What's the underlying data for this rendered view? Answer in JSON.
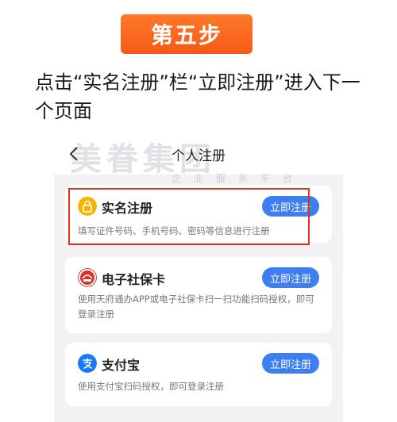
{
  "step_badge": "第五步",
  "instruction": "点击“实名注册”栏“立即注册”进入下一个页面",
  "phone": {
    "header": {
      "title": "个人注册",
      "back_icon": "chevron-left-icon"
    },
    "watermark": {
      "main": "美眷集团",
      "sub": "企业服务平台"
    },
    "cards": [
      {
        "title": "实名注册",
        "description": "填写证件号码、手机号码、密码等信息进行注册",
        "button": "立即注册",
        "icon": "lock-icon",
        "icon_color": "#f5b400"
      },
      {
        "title": "电子社保卡",
        "description": "使用天府通办APP或电子社保卡扫一扫功能扫码授权，即可登录注册",
        "button": "立即注册",
        "icon": "social-security-card-icon",
        "icon_color": "#d8322a"
      },
      {
        "title": "支付宝",
        "description": "使用支付宝扫码授权，即可登录注册",
        "button": "立即注册",
        "icon": "alipay-icon",
        "icon_color": "#1677ff"
      }
    ]
  },
  "colors": {
    "badge": "#f45a16",
    "button": "#3d7ef0",
    "highlight": "#e0301e",
    "background": "#f2f2f4"
  }
}
